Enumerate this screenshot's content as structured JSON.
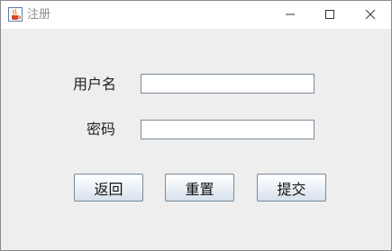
{
  "window": {
    "title": "注册",
    "icon": "java-cup-icon",
    "controls": {
      "minimize": "minimize-icon",
      "maximize": "maximize-icon",
      "close": "close-icon"
    }
  },
  "form": {
    "username_label": "用户名",
    "username_value": "",
    "password_label": "密码",
    "password_value": ""
  },
  "buttons": {
    "back": "返回",
    "reset": "重置",
    "submit": "提交"
  },
  "colors": {
    "titlebar": "#ffffff",
    "content_bg": "#eeeeee",
    "button_border": "#7a8a99"
  }
}
